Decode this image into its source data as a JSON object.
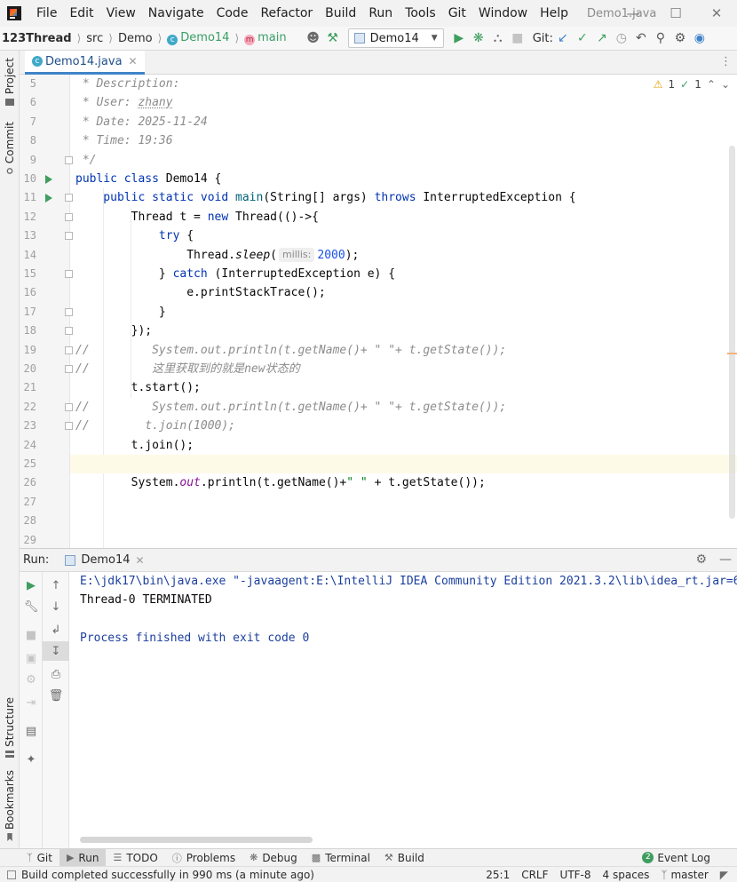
{
  "menubar": {
    "items": [
      "File",
      "Edit",
      "View",
      "Navigate",
      "Code",
      "Refactor",
      "Build",
      "Run",
      "Tools",
      "Git",
      "Window",
      "Help"
    ],
    "window_title": "Demo1.java"
  },
  "navbar": {
    "project": "123Thread",
    "crumbs": [
      "src",
      "Demo",
      "Demo14",
      "main"
    ],
    "run_config": "Demo14",
    "git_label": "Git:"
  },
  "left_strip": {
    "project": "Project",
    "commit": "Commit",
    "structure": "Structure",
    "bookmarks": "Bookmarks"
  },
  "editor_tab": {
    "label": "Demo14.java"
  },
  "inspection": {
    "warnings": "1",
    "weak": "1"
  },
  "editor": {
    "line_numbers": [
      "5",
      "6",
      "7",
      "8",
      "9",
      "10",
      "11",
      "12",
      "13",
      "14",
      "15",
      "16",
      "17",
      "18",
      "19",
      "20",
      "21",
      "22",
      "23",
      "24",
      "25",
      "26",
      "27",
      "28",
      "29"
    ],
    "comment_lines": {
      "description": " * Description:",
      "user_prefix": " * User: ",
      "user": "zhany",
      "date": " * Date: 2025-11-24",
      "time": " * Time: 19:36",
      "end": " */"
    },
    "code": {
      "class_kw": "public class ",
      "class_name": "Demo14 {",
      "main_kw": "    public static void ",
      "main_name": "main",
      "main_rest": "(String[] args) ",
      "throws_kw": "throws",
      "main_exc": " InterruptedException {",
      "thread_pre": "        Thread t = ",
      "new_kw": "new",
      "thread_post": " Thread(()->{",
      "try_kw": "            try",
      "try_brace": " {",
      "sleep_pre": "                Thread.",
      "sleep_fn": "sleep",
      "sleep_open": "(",
      "sleep_hint": "millis:",
      "sleep_val": "2000",
      "sleep_close": ");",
      "catch_pre": "            } ",
      "catch_kw": "catch",
      "catch_post": " (InterruptedException e) {",
      "print_trace": "                e.printStackTrace();",
      "close_brace": "            }",
      "close_lambda": "        });",
      "c19": "//         System.out.println(t.getName()+ \" \"+ t.getState());",
      "c20": "//         这里获取到的就是new状态的",
      "start": "        t.start();",
      "c22": "//         System.out.println(t.getName()+ \" \"+ t.getState());",
      "c23": "//        t.join(1000);",
      "join": "        t.join();",
      "blank": "",
      "sys_pre": "        System.",
      "sys_out": "out",
      "sys_mid": ".println(t.getName()+",
      "sys_str": "\" \"",
      "sys_post": " + t.getState());"
    }
  },
  "run_panel": {
    "label": "Run:",
    "tab": "Demo14",
    "console": [
      "E:\\jdk17\\bin\\java.exe \"-javaagent:E:\\IntelliJ IDEA Community Edition 2021.3.2\\lib\\idea_rt.jar=6",
      "Thread-0 TERMINATED",
      "",
      "Process finished with exit code 0"
    ]
  },
  "tool_tabs": {
    "git": "Git",
    "run": "Run",
    "todo": "TODO",
    "problems": "Problems",
    "debug": "Debug",
    "terminal": "Terminal",
    "build": "Build",
    "event_log": "Event Log",
    "event_count": "2"
  },
  "status": {
    "message": "Build completed successfully in 990 ms (a minute ago)",
    "position": "25:1",
    "line_sep": "CRLF",
    "encoding": "UTF-8",
    "indent": "4 spaces",
    "branch": "master"
  },
  "colors": {
    "accent": "#4083c9",
    "run_green": "#3e9e5f",
    "keyword": "#0033b3",
    "comment": "#8c8c8c"
  }
}
